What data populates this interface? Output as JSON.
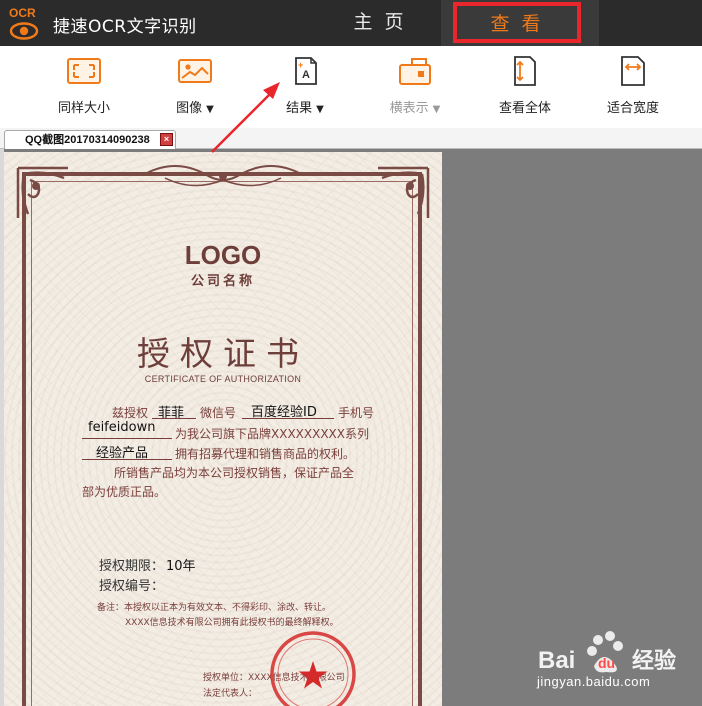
{
  "app": {
    "logo_label": "OCR",
    "title": "捷速OCR文字识别",
    "nav": {
      "home": "主 页",
      "view": "查 看"
    }
  },
  "toolbar": {
    "same_size": "同样大小",
    "image": "图像",
    "result": "结果",
    "landscape": "横表示",
    "view_all": "查看全体",
    "fit_width": "适合宽度",
    "caret": "▼"
  },
  "document_tab": {
    "label": "QQ截图20170314090238",
    "close": "×"
  },
  "certificate": {
    "logo": "LOGO",
    "company": "公司名称",
    "title": "授权证书",
    "subtitle": "CERTIFICATE OF AUTHORIZATION",
    "line1": {
      "prefix": "兹授权",
      "name_value": "菲菲",
      "wechat_label": "微信号",
      "wechat_value": "百度经验ID",
      "phone_label": "手机号"
    },
    "line2": {
      "value": "feifeidown",
      "text": "为我公司旗下品牌XXXXXXXXX系列"
    },
    "line3": {
      "value": "经验产品",
      "text": "拥有招募代理和销售商品的权利。"
    },
    "line4": "所销售产品均为本公司授权销售，保证产品全",
    "line5": "部为优质正品。",
    "period_label": "授权期限：",
    "period_value": "10年",
    "number_label": "授权编号：",
    "note1": "备注：本授权以正本为有效文本、不得彩印、涂改、转让。",
    "note2": "XXXX信息技术有限公司拥有此授权书的最终解释权。",
    "unit_label": "授权单位：XXXX信息技术有限公司",
    "rep_label": "法定代表人：",
    "seal_text": "XXXX信息技术有限公司"
  },
  "watermark": {
    "brand": "Bai",
    "brand_du": "du",
    "brand_cn": "经验",
    "url": "jingyan.baidu.com"
  },
  "colors": {
    "titlebar_bg": "#2b2b2b",
    "accent_orange": "#f07a1a",
    "highlight_red": "#e8262c",
    "viewer_bg": "#7c7c7c",
    "cert_brown": "#6e3f3a"
  }
}
